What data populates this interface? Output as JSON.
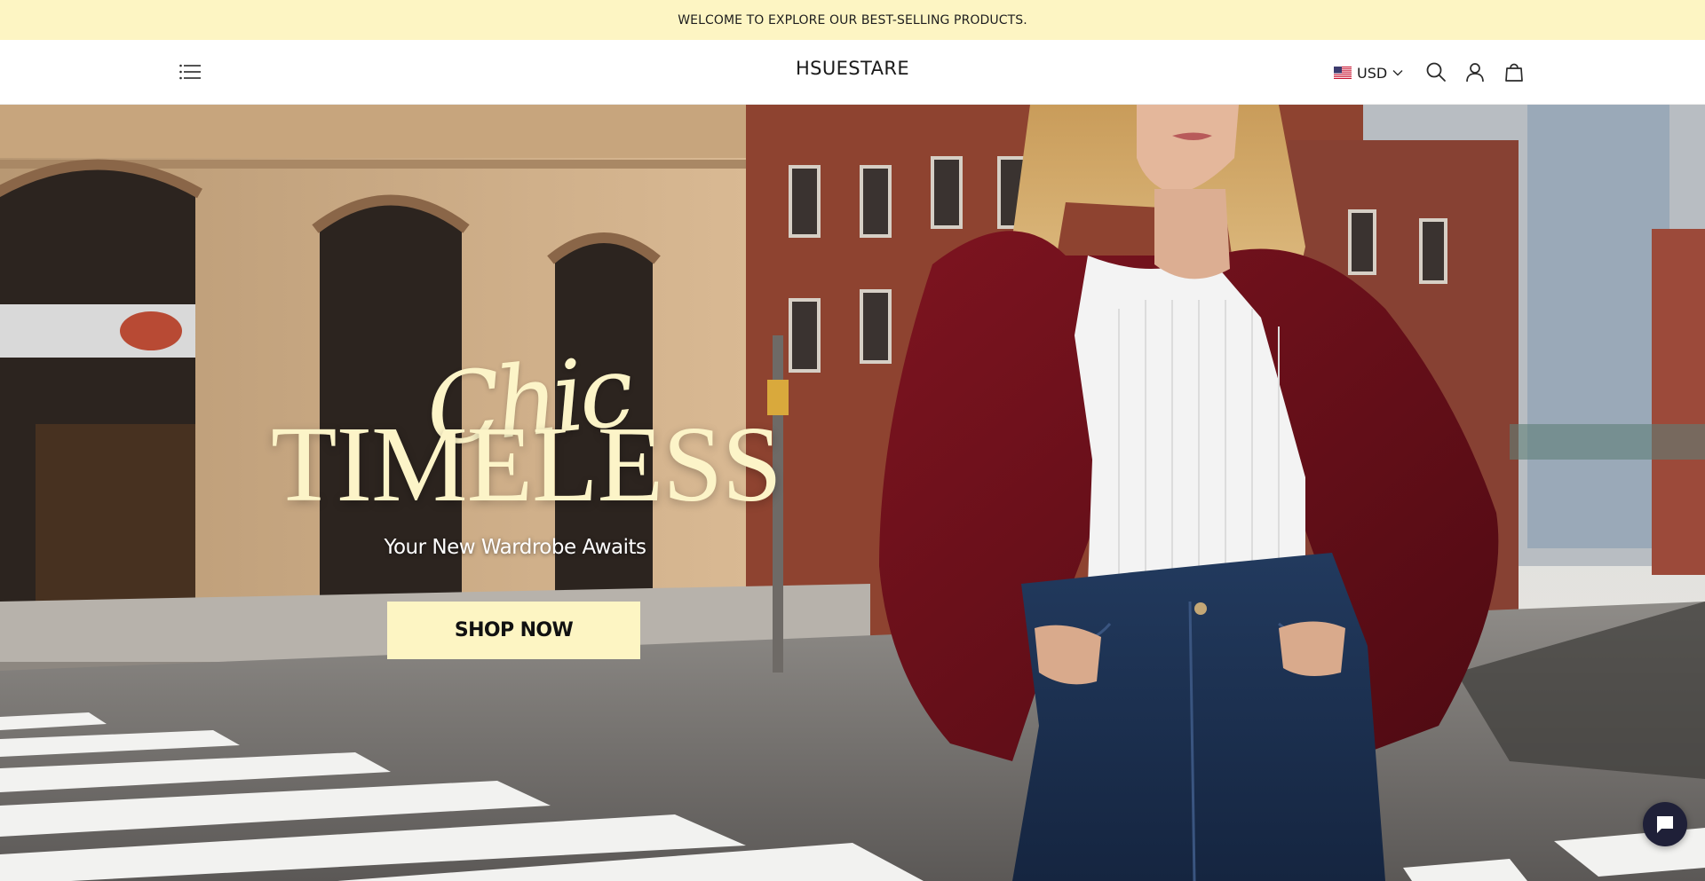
{
  "announcement": {
    "text": "WELCOME TO EXPLORE OUR BEST-SELLING PRODUCTS."
  },
  "header": {
    "logo": "HSUESTARE",
    "currency": {
      "code": "USD",
      "flag_icon": "us-flag-icon"
    },
    "icons": [
      "menu-icon",
      "search-icon",
      "account-icon",
      "cart-icon",
      "chevron-down-icon"
    ]
  },
  "hero": {
    "script_text": "Chic",
    "headline": "TIMELESS",
    "subheadline": "Your New Wardrobe Awaits",
    "cta_label": "SHOP NOW"
  },
  "chat": {
    "icon": "chat-bubble-icon"
  },
  "colors": {
    "announcement_bg": "#fdf5c3",
    "cta_bg": "#fdf5c3",
    "headline": "#fcf4c8",
    "chat_bg": "#1f2038"
  }
}
